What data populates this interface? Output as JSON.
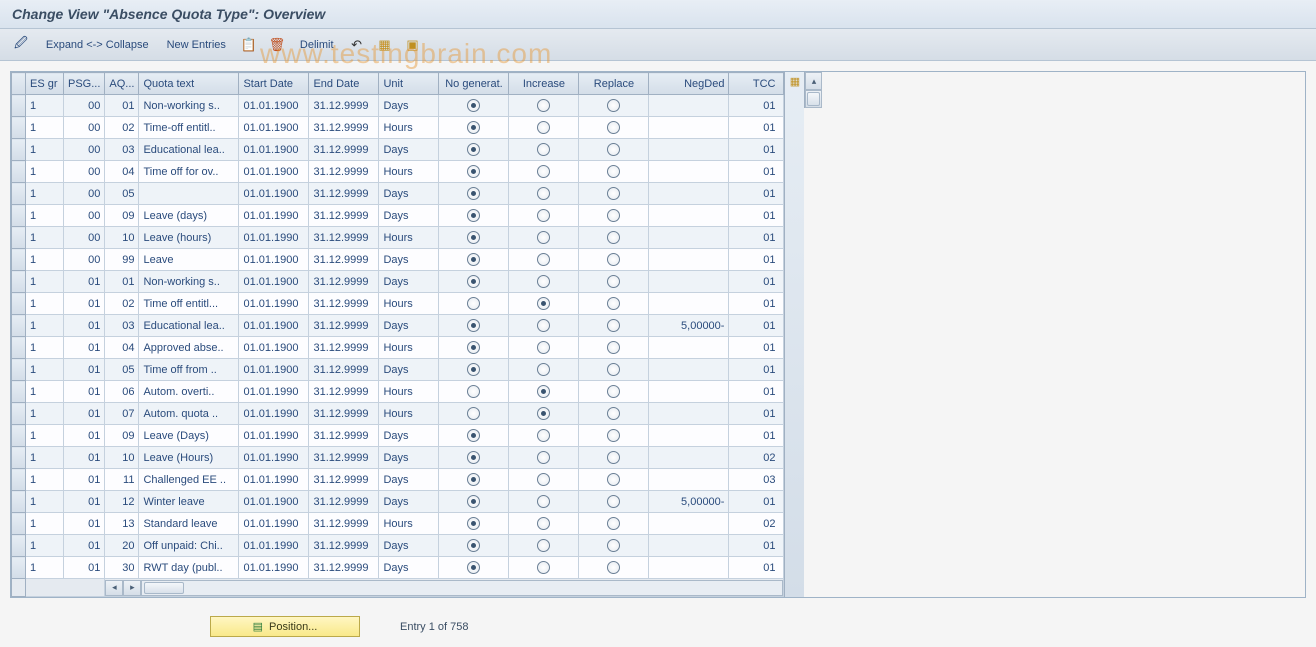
{
  "header": {
    "title": "Change View \"Absence Quota Type\": Overview"
  },
  "toolbar": {
    "expand_collapse": "Expand <-> Collapse",
    "new_entries": "New Entries",
    "delimit": "Delimit"
  },
  "watermark": "www.testingbrain.com",
  "columns": {
    "rowsel": "",
    "esgr": "ES gr",
    "psg": "PSG...",
    "aq": "AQ...",
    "qtext": "Quota text",
    "start": "Start Date",
    "end": "End Date",
    "unit": "Unit",
    "nogen": "No generat.",
    "increase": "Increase",
    "replace": "Replace",
    "negded": "NegDed",
    "tcc": "TCC"
  },
  "rows": [
    {
      "esgr": "1",
      "psg": "00",
      "aq": "01",
      "qtext": "Non-working s..",
      "start": "01.01.1900",
      "end": "31.12.9999",
      "unit": "Days",
      "sel": "nogen",
      "neg": "",
      "tcc": "01"
    },
    {
      "esgr": "1",
      "psg": "00",
      "aq": "02",
      "qtext": "Time-off entitl..",
      "start": "01.01.1900",
      "end": "31.12.9999",
      "unit": "Hours",
      "sel": "nogen",
      "neg": "",
      "tcc": "01"
    },
    {
      "esgr": "1",
      "psg": "00",
      "aq": "03",
      "qtext": "Educational lea..",
      "start": "01.01.1900",
      "end": "31.12.9999",
      "unit": "Days",
      "sel": "nogen",
      "neg": "",
      "tcc": "01"
    },
    {
      "esgr": "1",
      "psg": "00",
      "aq": "04",
      "qtext": "Time off for ov..",
      "start": "01.01.1900",
      "end": "31.12.9999",
      "unit": "Hours",
      "sel": "nogen",
      "neg": "",
      "tcc": "01"
    },
    {
      "esgr": "1",
      "psg": "00",
      "aq": "05",
      "qtext": "",
      "start": "01.01.1900",
      "end": "31.12.9999",
      "unit": "Days",
      "sel": "nogen",
      "neg": "",
      "tcc": "01"
    },
    {
      "esgr": "1",
      "psg": "00",
      "aq": "09",
      "qtext": "Leave (days)",
      "start": "01.01.1990",
      "end": "31.12.9999",
      "unit": "Days",
      "sel": "nogen",
      "neg": "",
      "tcc": "01"
    },
    {
      "esgr": "1",
      "psg": "00",
      "aq": "10",
      "qtext": "Leave (hours)",
      "start": "01.01.1990",
      "end": "31.12.9999",
      "unit": "Hours",
      "sel": "nogen",
      "neg": "",
      "tcc": "01"
    },
    {
      "esgr": "1",
      "psg": "00",
      "aq": "99",
      "qtext": "Leave",
      "start": "01.01.1900",
      "end": "31.12.9999",
      "unit": "Days",
      "sel": "nogen",
      "neg": "",
      "tcc": "01"
    },
    {
      "esgr": "1",
      "psg": "01",
      "aq": "01",
      "qtext": "Non-working s..",
      "start": "01.01.1900",
      "end": "31.12.9999",
      "unit": "Days",
      "sel": "nogen",
      "neg": "",
      "tcc": "01"
    },
    {
      "esgr": "1",
      "psg": "01",
      "aq": "02",
      "qtext": "Time off entitl...",
      "start": "01.01.1990",
      "end": "31.12.9999",
      "unit": "Hours",
      "sel": "increase",
      "neg": "",
      "tcc": "01"
    },
    {
      "esgr": "1",
      "psg": "01",
      "aq": "03",
      "qtext": "Educational lea..",
      "start": "01.01.1900",
      "end": "31.12.9999",
      "unit": "Days",
      "sel": "nogen",
      "neg": "5,00000-",
      "tcc": "01"
    },
    {
      "esgr": "1",
      "psg": "01",
      "aq": "04",
      "qtext": "Approved abse..",
      "start": "01.01.1900",
      "end": "31.12.9999",
      "unit": "Hours",
      "sel": "nogen",
      "neg": "",
      "tcc": "01"
    },
    {
      "esgr": "1",
      "psg": "01",
      "aq": "05",
      "qtext": "Time off from ..",
      "start": "01.01.1900",
      "end": "31.12.9999",
      "unit": "Days",
      "sel": "nogen",
      "neg": "",
      "tcc": "01"
    },
    {
      "esgr": "1",
      "psg": "01",
      "aq": "06",
      "qtext": "Autom. overti..",
      "start": "01.01.1990",
      "end": "31.12.9999",
      "unit": "Hours",
      "sel": "increase",
      "neg": "",
      "tcc": "01"
    },
    {
      "esgr": "1",
      "psg": "01",
      "aq": "07",
      "qtext": "Autom. quota ..",
      "start": "01.01.1990",
      "end": "31.12.9999",
      "unit": "Hours",
      "sel": "increase",
      "neg": "",
      "tcc": "01"
    },
    {
      "esgr": "1",
      "psg": "01",
      "aq": "09",
      "qtext": "Leave (Days)",
      "start": "01.01.1990",
      "end": "31.12.9999",
      "unit": "Days",
      "sel": "nogen",
      "neg": "",
      "tcc": "01"
    },
    {
      "esgr": "1",
      "psg": "01",
      "aq": "10",
      "qtext": "Leave (Hours)",
      "start": "01.01.1990",
      "end": "31.12.9999",
      "unit": "Days",
      "sel": "nogen",
      "neg": "",
      "tcc": "02"
    },
    {
      "esgr": "1",
      "psg": "01",
      "aq": "11",
      "qtext": "Challenged EE ..",
      "start": "01.01.1990",
      "end": "31.12.9999",
      "unit": "Days",
      "sel": "nogen",
      "neg": "",
      "tcc": "03"
    },
    {
      "esgr": "1",
      "psg": "01",
      "aq": "12",
      "qtext": "Winter leave",
      "start": "01.01.1900",
      "end": "31.12.9999",
      "unit": "Days",
      "sel": "nogen",
      "neg": "5,00000-",
      "tcc": "01"
    },
    {
      "esgr": "1",
      "psg": "01",
      "aq": "13",
      "qtext": "Standard leave",
      "start": "01.01.1990",
      "end": "31.12.9999",
      "unit": "Hours",
      "sel": "nogen",
      "neg": "",
      "tcc": "02"
    },
    {
      "esgr": "1",
      "psg": "01",
      "aq": "20",
      "qtext": "Off unpaid: Chi..",
      "start": "01.01.1990",
      "end": "31.12.9999",
      "unit": "Days",
      "sel": "nogen",
      "neg": "",
      "tcc": "01"
    },
    {
      "esgr": "1",
      "psg": "01",
      "aq": "30",
      "qtext": "RWT day (publ..",
      "start": "01.01.1990",
      "end": "31.12.9999",
      "unit": "Days",
      "sel": "nogen",
      "neg": "",
      "tcc": "01"
    }
  ],
  "footer": {
    "position_label": "Position...",
    "entry_text": "Entry 1 of 758"
  }
}
